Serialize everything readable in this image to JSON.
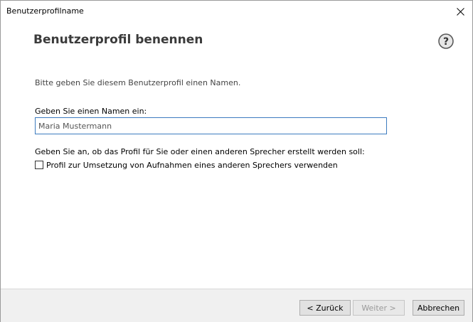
{
  "window": {
    "title": "Benutzerprofilname"
  },
  "main": {
    "heading": "Benutzerprofil benennen",
    "intro": "Bitte geben Sie diesem Benutzerprofil einen Namen.",
    "name_label": "Geben Sie einen Namen ein:",
    "name_value": "Maria Mustermann",
    "speaker_label": "Geben Sie an, ob das Profil für Sie oder einen anderen Sprecher erstellt werden soll:",
    "checkbox_label": "Profil zur Umsetzung von Aufnahmen eines anderen Sprechers verwenden",
    "checkbox_checked": false
  },
  "footer": {
    "back_label": "< Zurück",
    "next_label": "Weiter >",
    "cancel_label": "Abbrechen"
  },
  "icons": {
    "close": "close-icon",
    "help": "help-icon"
  },
  "colors": {
    "input_border": "#3d7bbf",
    "footer_bg": "#f0f0f0",
    "disabled_text": "#9a9a9a"
  }
}
